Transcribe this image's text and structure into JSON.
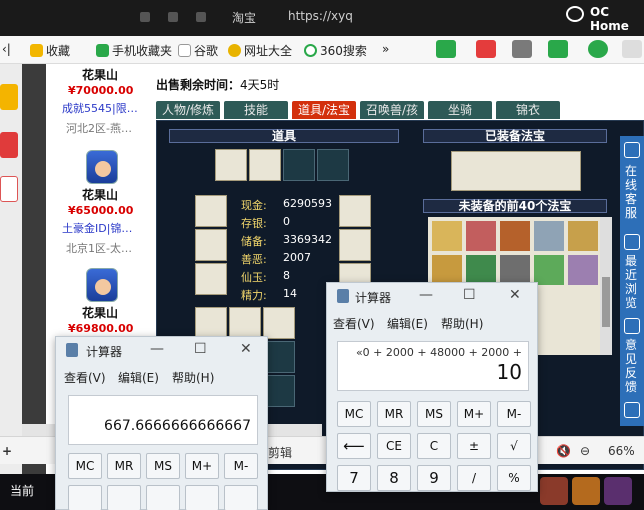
{
  "browser": {
    "title_fragment": "淘宝",
    "url_fragment": "https://xyq",
    "watermark": "OC Home",
    "bookmarks": [
      "收藏",
      "手机收藏夹",
      "谷歌",
      "网址大全",
      "360搜索"
    ],
    "more": "»"
  },
  "sellers": [
    {
      "name": "花果山",
      "price": "¥70000.00",
      "id": "成就5545|限…",
      "server": "河北2区-燕…"
    },
    {
      "name": "花果山",
      "price": "¥65000.00",
      "id": "土豪金ID|锦…",
      "server": "北京1区-太…"
    },
    {
      "name": "花果山",
      "price": "¥69800.00",
      "id": "",
      "server": ""
    }
  ],
  "game": {
    "sale_label": "出售剩余时间：",
    "sale_value": "4天5时",
    "tabs": [
      "人物/修炼",
      "技能",
      "道具/法宝",
      "召唤兽/孩",
      "坐骑",
      "锦衣"
    ],
    "active_tab": "道具/法宝",
    "items_header": "道具",
    "equipped_header": "已装备法宝",
    "unequipped_header": "未装备的前40个法宝",
    "stats": [
      {
        "label": "现金:",
        "value": "6290593"
      },
      {
        "label": "存银:",
        "value": "0"
      },
      {
        "label": "储备:",
        "value": "3369342"
      },
      {
        "label": "善恶:",
        "value": "2007"
      },
      {
        "label": "仙玉:",
        "value": "8"
      },
      {
        "label": "精力:",
        "value": "14"
      }
    ]
  },
  "right_sidebar": [
    "在线客服",
    "最近浏览",
    "意见反馈"
  ],
  "status_bar": {
    "clip": "剪辑",
    "zoom": "66%",
    "taskbar_first": "当前"
  },
  "calc_left": {
    "title": "计算器",
    "menu": [
      "查看(V)",
      "编辑(E)",
      "帮助(H)"
    ],
    "expression": "",
    "result": "667.6666666666667",
    "keys": [
      "MC",
      "MR",
      "MS",
      "M+",
      "M-"
    ]
  },
  "calc_right": {
    "title": "计算器",
    "menu": [
      "查看(V)",
      "编辑(E)",
      "帮助(H)"
    ],
    "expression": "«0 + 2000 + 48000 + 2000 +",
    "result": "10",
    "keys_row1": [
      "MC",
      "MR",
      "MS",
      "M+",
      "M-"
    ],
    "keys_row2": [
      "⟵",
      "CE",
      "C",
      "±",
      "√"
    ],
    "keys_row3": [
      "7",
      "8",
      "9",
      "/",
      "%"
    ]
  },
  "colors": {
    "price_red": "#d80000",
    "id_blue": "#2b39c8",
    "tab_active": "#d3300c",
    "tab": "#2e5a57",
    "game_bg": "#0f1a29",
    "sidebar_blue": "#2d6fb8"
  }
}
